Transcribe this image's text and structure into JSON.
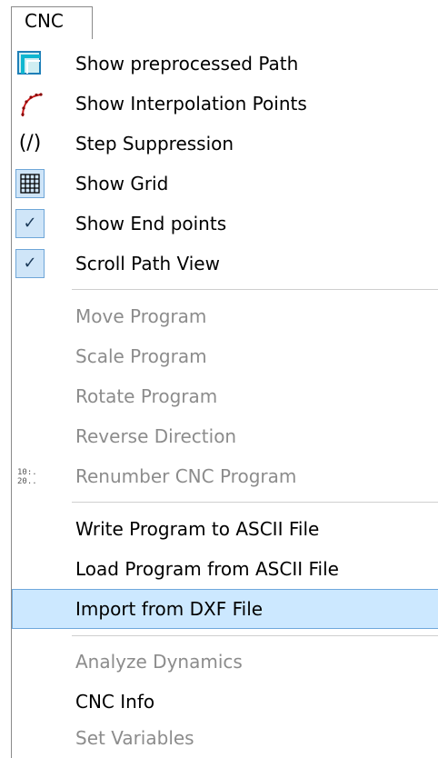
{
  "menu": {
    "title": "CNC",
    "items": [
      {
        "label": "Show preprocessed Path",
        "icon": "preprocessed-path-icon"
      },
      {
        "label": "Show Interpolation Points",
        "icon": "interpolation-points-icon"
      },
      {
        "label": "Step Suppression",
        "icon": "step-suppression-icon",
        "icon_text": "(/)"
      },
      {
        "label": "Show Grid",
        "icon": "grid-icon"
      },
      {
        "label": "Show End points",
        "icon": "checkmark-icon",
        "checked": true
      },
      {
        "label": "Scroll Path View",
        "icon": "checkmark-icon",
        "checked": true
      },
      {
        "label": "Move Program",
        "disabled": true
      },
      {
        "label": "Scale Program",
        "disabled": true
      },
      {
        "label": "Rotate Program",
        "disabled": true
      },
      {
        "label": "Reverse Direction",
        "disabled": true
      },
      {
        "label": "Renumber CNC Program",
        "disabled": true,
        "icon": "renumber-icon",
        "icon_text": "10:.\n20.."
      },
      {
        "label": "Write Program to ASCII File"
      },
      {
        "label": "Load Program from ASCII File"
      },
      {
        "label": "Import from DXF File",
        "highlighted": true
      },
      {
        "label": "Analyze Dynamics",
        "disabled": true
      },
      {
        "label": "CNC Info"
      },
      {
        "label": "Set Variables",
        "disabled": true
      }
    ]
  },
  "colors": {
    "highlight_bg": "#cce8ff",
    "highlight_border": "#6fa8dc",
    "checkbox_bg": "#cfe5f8",
    "disabled_text": "#8c8c8c"
  },
  "glyphs": {
    "check": "✓"
  }
}
